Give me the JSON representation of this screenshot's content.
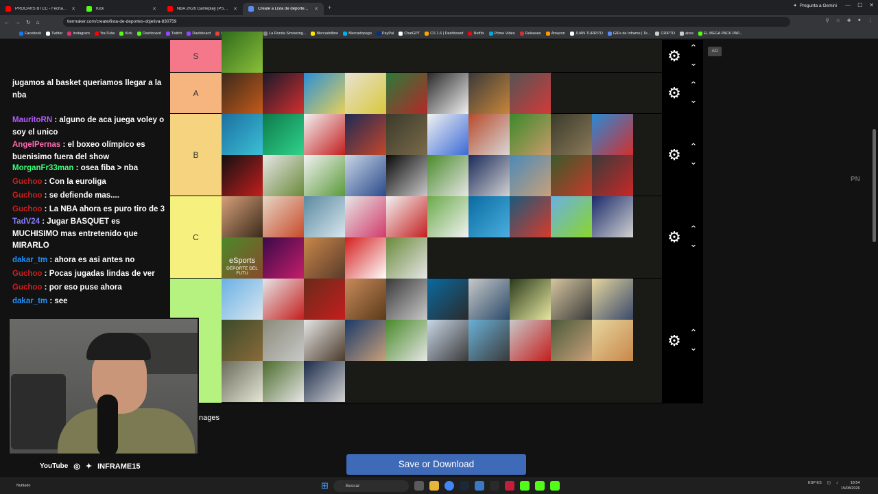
{
  "browser": {
    "tabs": [
      {
        "title": "PROCARS BTCC - Fecha 2 - Cro",
        "favicon_color": "#ff0000",
        "active": false
      },
      {
        "title": "Kick",
        "favicon_color": "#53fc18",
        "active": false
      },
      {
        "title": "NBA 2K26 Gameplay (PS5 UHD",
        "favicon_color": "#ff0000",
        "active": false
      },
      {
        "title": "Create a Lista de deportes (obje",
        "favicon_color": "#5b8def",
        "active": true
      }
    ],
    "new_tab": "+",
    "gemini_label": "Pregunta a Gemini",
    "url": "tiermaker.com/create/lista-de-deportes-objetiva-830759",
    "bookmarks": [
      {
        "label": "Facebook",
        "color": "#1877f2"
      },
      {
        "label": "Twitter",
        "color": "#ffffff"
      },
      {
        "label": "Instagram",
        "color": "#e1306c"
      },
      {
        "label": "YouTube",
        "color": "#ff0000"
      },
      {
        "label": "Kick",
        "color": "#53fc18"
      },
      {
        "label": "Dashboard",
        "color": "#53fc18"
      },
      {
        "label": "Twitch",
        "color": "#9146ff"
      },
      {
        "label": "Dashboard",
        "color": "#9146ff"
      },
      {
        "label": "Gmail",
        "color": "#ea4335"
      },
      {
        "label": "WhatsApp",
        "color": "#25d366"
      },
      {
        "label": "La Ronda Simracing...",
        "color": "#888888"
      },
      {
        "label": "Mercadolibre",
        "color": "#ffe600"
      },
      {
        "label": "Mercadopago",
        "color": "#00b1ea"
      },
      {
        "label": "PayPal",
        "color": "#003087"
      },
      {
        "label": "ChatGPT",
        "color": "#ffffff"
      },
      {
        "label": "CS 1.6 | Dashboard",
        "color": "#ffa500"
      },
      {
        "label": "Netflix",
        "color": "#e50914"
      },
      {
        "label": "Prime Video",
        "color": "#00a8e1"
      },
      {
        "label": "Releases",
        "color": "#cc3333"
      },
      {
        "label": "Amazon",
        "color": "#ff9900"
      },
      {
        "label": "JUAN TURRITO",
        "color": "#ffffff"
      },
      {
        "label": "GIFs de Inframe | Te...",
        "color": "#5b8def"
      },
      {
        "label": "CRIPTO",
        "color": "#cccccc"
      },
      {
        "label": "aires",
        "color": "#cccccc"
      },
      {
        "label": "EL MEGA PACK PAP...",
        "color": "#53fc18"
      }
    ]
  },
  "chat": {
    "messages": [
      {
        "user": "",
        "user_color": "#1e90ff",
        "text": "jugamos al basket queriamos llegar a la nba"
      },
      {
        "user": "MauritoRN",
        "user_color": "#b45cff",
        "text": "alguno de aca juega voley o soy el unico"
      },
      {
        "user": "AngelPernas",
        "user_color": "#ff69b4",
        "text": "el boxeo olímpico es buenisimo fuera del show"
      },
      {
        "user": "MorganFr33man",
        "user_color": "#3cff7a",
        "text": "osea fiba > nba"
      },
      {
        "user": "Guchoo",
        "user_color": "#cc1f1f",
        "text": "Con la euroliga"
      },
      {
        "user": "Guchoo",
        "user_color": "#cc1f1f",
        "text": "se defiende mas...."
      },
      {
        "user": "Guchoo",
        "user_color": "#cc1f1f",
        "text": "La NBA ahora es puro tiro de 3"
      },
      {
        "user": "TadV24",
        "user_color": "#8a7dff",
        "text": "Jugar BASQUET es MUCHISIMO mas entretenido que MIRARLO"
      },
      {
        "user": "dakar_tm",
        "user_color": "#1e90ff",
        "text": "ahora es asi antes no"
      },
      {
        "user": "Guchoo",
        "user_color": "#cc1f1f",
        "text": "Pocas jugadas lindas de ver"
      },
      {
        "user": "Guchoo",
        "user_color": "#cc1f1f",
        "text": "por eso puse ahora"
      },
      {
        "user": "dakar_tm",
        "user_color": "#1e90ff",
        "text": "see"
      }
    ]
  },
  "stream_overlay": {
    "youtube_label": "YouTube",
    "handle": "INFRAME15"
  },
  "tierlist": {
    "tiers": [
      {
        "label": "S",
        "color": "#f4778a",
        "tiles": [
          {
            "c1": "#2f6b1c",
            "c2": "#8bbf3a"
          }
        ]
      },
      {
        "label": "A",
        "color": "#f6b47f",
        "tiles": [
          {
            "c1": "#3a2a1c",
            "c2": "#c45a1a"
          },
          {
            "c1": "#1a1a2a",
            "c2": "#d22f2f"
          },
          {
            "c1": "#2a8fd6",
            "c2": "#e6d05a"
          },
          {
            "c1": "#e8e2d2",
            "c2": "#d8c83a"
          },
          {
            "c1": "#2b7a3a",
            "c2": "#b42828"
          },
          {
            "c1": "#2a2a2a",
            "c2": "#f0f0f0"
          },
          {
            "c1": "#3a3a3a",
            "c2": "#c8863a"
          },
          {
            "c1": "#545454",
            "c2": "#d23a3a"
          }
        ]
      },
      {
        "label": "B",
        "color": "#f6d37f",
        "tiles": [
          {
            "c1": "#1b6fa0",
            "c2": "#3cc0d6"
          },
          {
            "c1": "#0d7a4a",
            "c2": "#2fd38a"
          },
          {
            "c1": "#f2f2f2",
            "c2": "#c41e1e"
          },
          {
            "c1": "#1d2a55",
            "c2": "#c4472a"
          },
          {
            "c1": "#3a3a2a",
            "c2": "#7a6a4a"
          },
          {
            "c1": "#f2f2f2",
            "c2": "#3a6ad6"
          },
          {
            "c1": "#b84a2a",
            "c2": "#d8d8d8"
          },
          {
            "c1": "#3a8a2a",
            "c2": "#c89a6a"
          },
          {
            "c1": "#3a3a2a",
            "c2": "#8a7a5a"
          },
          {
            "c1": "#2a8ad6",
            "c2": "#d22f2f"
          },
          {
            "c1": "#111111",
            "c2": "#c41e1e"
          },
          {
            "c1": "#e6e6e6",
            "c2": "#6a8a3a"
          },
          {
            "c1": "#f2f2f2",
            "c2": "#5a9a3a"
          },
          {
            "c1": "#c8d6e6",
            "c2": "#2a4a8a"
          },
          {
            "c1": "#0a0a0a",
            "c2": "#c8c8c8"
          },
          {
            "c1": "#4a8a2a",
            "c2": "#e6e6e6"
          },
          {
            "c1": "#1a2a5a",
            "c2": "#d2d2d2"
          },
          {
            "c1": "#4a8ab8",
            "c2": "#c8a07a"
          },
          {
            "c1": "#3a5a2a",
            "c2": "#c43a2a"
          },
          {
            "c1": "#3a3a3a",
            "c2": "#c82828"
          }
        ]
      },
      {
        "label": "C",
        "color": "#f6f07f",
        "tiles": [
          {
            "c1": "#d6a07a",
            "c2": "#3a2a1a"
          },
          {
            "c1": "#e6d6c6",
            "c2": "#c84a2a"
          },
          {
            "c1": "#5a8aa0",
            "c2": "#d8e6ee"
          },
          {
            "c1": "#e6e6e6",
            "c2": "#d23a6a"
          },
          {
            "c1": "#f2f2f2",
            "c2": "#c41e1e"
          },
          {
            "c1": "#6aaa4a",
            "c2": "#f2f2f2"
          },
          {
            "c1": "#0a6aa0",
            "c2": "#4ab0e0"
          },
          {
            "c1": "#1a5a7a",
            "c2": "#d83a2a"
          },
          {
            "c1": "#6ab0e6",
            "c2": "#8ad62a"
          },
          {
            "c1": "#1a2a6a",
            "c2": "#d2d2d2"
          },
          {
            "c1": "#4a8a2a",
            "c2": "#8a4a2a"
          },
          {
            "c1": "#3a0a4a",
            "c2": "#c41e6a"
          },
          {
            "c1": "#c8884a",
            "c2": "#5a3a2a"
          },
          {
            "c1": "#d41e1e",
            "c2": "#ffffff"
          },
          {
            "c1": "#6a8a3a",
            "c2": "#e6e6e6"
          }
        ],
        "tile_text": {
          "index": 10,
          "lines": [
            "eSports",
            "DEPORTE DEL FUTU"
          ]
        }
      },
      {
        "label": "",
        "color": "#b6f27f",
        "tiles": [
          {
            "c1": "#6ab0e6",
            "c2": "#d8e6ee"
          },
          {
            "c1": "#e6e6e6",
            "c2": "#c41e1e"
          },
          {
            "c1": "#6a2a1a",
            "c2": "#c41e1e"
          },
          {
            "c1": "#c88a5a",
            "c2": "#5a3a1a"
          },
          {
            "c1": "#3a3a3a",
            "c2": "#c8c8c8"
          },
          {
            "c1": "#0a6aa0",
            "c2": "#2a2a2a"
          },
          {
            "c1": "#c8c8c8",
            "c2": "#2a4a6a"
          },
          {
            "c1": "#2a3a1a",
            "c2": "#e6e6a0"
          },
          {
            "c1": "#d6c6a0",
            "c2": "#3a3a3a"
          },
          {
            "c1": "#e6d6a0",
            "c2": "#3a4a6a"
          },
          {
            "c1": "#3a4a2a",
            "c2": "#8a6a3a"
          },
          {
            "c1": "#8a8a7a",
            "c2": "#c8c8c8"
          },
          {
            "c1": "#e6e6e6",
            "c2": "#4a3a2a"
          },
          {
            "c1": "#1a3a6a",
            "c2": "#c8a07a"
          },
          {
            "c1": "#4a8a2a",
            "c2": "#e6e6e6"
          },
          {
            "c1": "#c8d6e6",
            "c2": "#3a3a3a"
          },
          {
            "c1": "#6ab0d6",
            "c2": "#3a3a3a"
          },
          {
            "c1": "#c8c8c8",
            "c2": "#c41e1e"
          },
          {
            "c1": "#4a5a3a",
            "c2": "#c8a07a"
          },
          {
            "c1": "#e6d6a0",
            "c2": "#c8884a"
          },
          {
            "c1": "#6a6a5a",
            "c2": "#e6e6d6"
          },
          {
            "c1": "#4a6a2a",
            "c2": "#e6e6e6"
          },
          {
            "c1": "#1a2a4a",
            "c2": "#d2d2d2"
          }
        ]
      }
    ],
    "gear_icon": "⚙",
    "up_arrow": "⌃",
    "down_arrow": "⌄"
  },
  "ad_badge": "AD",
  "side_text": "PN",
  "images_label": "nages",
  "save_button": "Save or Download",
  "taskbar": {
    "weather": "Nublado",
    "search_placeholder": "Buscar",
    "language": "ESP ES",
    "time": "18:54",
    "date": "15/08/2026"
  }
}
